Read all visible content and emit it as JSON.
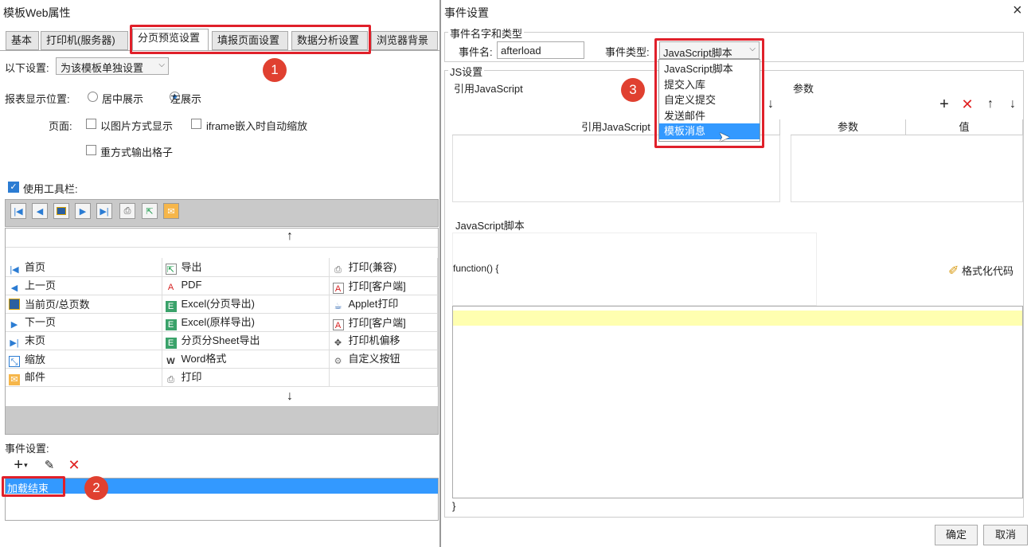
{
  "left": {
    "title": "模板Web属性",
    "tabs": [
      "基本",
      "打印机(服务器)",
      "分页预览设置",
      "填报页面设置",
      "数据分析设置",
      "浏览器背景"
    ],
    "scope_label": "以下设置:",
    "scope_value": "为该模板单独设置",
    "position_label": "报表显示位置:",
    "center_label": "居中展示",
    "left_label": "左展示",
    "page_label": "页面:",
    "image_mode": "以图片方式显示",
    "iframe_scale": "iframe嵌入时自动缩放",
    "repeat_output": "重方式输出格子",
    "use_toolbar": "使用工具栏:",
    "up_arrow": "↑",
    "down_arrow": "↓",
    "grid": [
      [
        "首页",
        "导出",
        "打印(兼容)"
      ],
      [
        "上一页",
        "PDF",
        "打印[客户端]"
      ],
      [
        "当前页/总页数",
        "Excel(分页导出)",
        "Applet打印"
      ],
      [
        "下一页",
        "Excel(原样导出)",
        "打印[客户端]"
      ],
      [
        "末页",
        "分页分Sheet导出",
        "打印机偏移"
      ],
      [
        "缩放",
        "Word格式",
        "自定义按钮"
      ],
      [
        "邮件",
        "打印",
        ""
      ]
    ],
    "event_label": "事件设置:",
    "event_item": "加载结束"
  },
  "right": {
    "title": "事件设置",
    "close": "×",
    "group_name_type": "事件名字和类型",
    "name_label": "事件名:",
    "name_value": "afterload",
    "type_label": "事件类型:",
    "type_value": "JavaScript脚本",
    "dropdown": [
      "JavaScript脚本",
      "提交入库",
      "自定义提交",
      "发送邮件",
      "模板消息"
    ],
    "js_group": "JS设置",
    "ref_js": "引用JavaScript",
    "ref_js_col": "引用JavaScript",
    "params": "参数",
    "param_col": "参数",
    "value_col": "值",
    "script_label": "JavaScript脚本",
    "func_header": "function() {",
    "format_code": "格式化代码",
    "closing_brace": "}",
    "ok": "确定",
    "cancel": "取消"
  },
  "badges": [
    "1",
    "2",
    "3"
  ],
  "colors": {
    "accent": "#2b7cd3",
    "highlight": "#e0202a",
    "selected_row": "#3399ff",
    "editor_line": "#ffffb0"
  }
}
